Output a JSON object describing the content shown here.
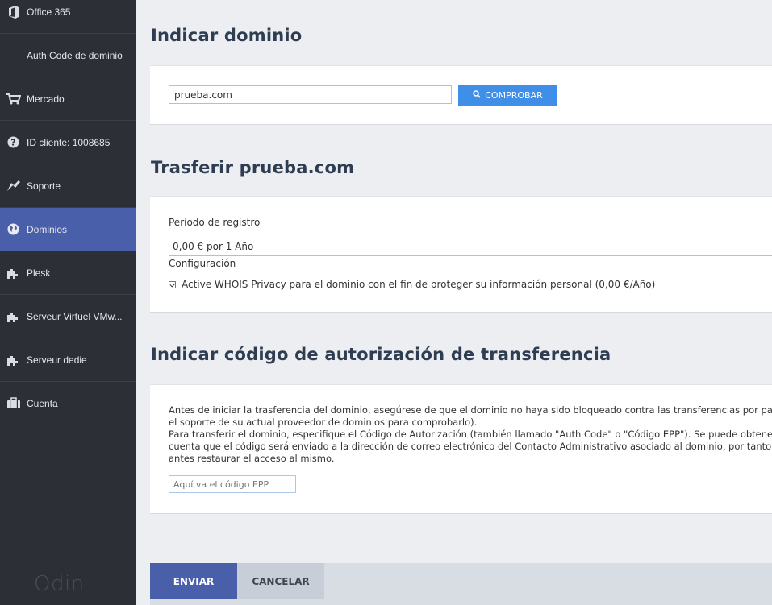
{
  "sidebar": {
    "items": [
      {
        "label": "Office 365",
        "icon": "office-icon"
      },
      {
        "label": "Auth Code de dominio",
        "icon": ""
      },
      {
        "label": "Mercado",
        "icon": "cart-icon"
      },
      {
        "label": "ID cliente: 1008685",
        "icon": "help-icon"
      },
      {
        "label": "Soporte",
        "icon": "support-icon"
      },
      {
        "label": "Dominios",
        "icon": "globe-icon"
      },
      {
        "label": "Plesk",
        "icon": "puzzle-icon"
      },
      {
        "label": "Serveur Virtuel VMw...",
        "icon": "puzzle-icon"
      },
      {
        "label": "Serveur dedie",
        "icon": "puzzle-icon"
      },
      {
        "label": "Cuenta",
        "icon": "briefcase-icon"
      }
    ],
    "active_index": 5,
    "brand": "Odin"
  },
  "colors": {
    "sidebar_bg": "#2c3036",
    "active": "#4a5faa",
    "primary_button": "#3f8ee8"
  },
  "domain_section": {
    "title": "Indicar dominio",
    "input_value": "prueba.com",
    "check_button": "COMPROBAR"
  },
  "transfer_section": {
    "title": "Trasferir prueba.com",
    "period_label": "Período de registro",
    "period_value": "0,00 € por 1 Año",
    "config_label": "Configuración",
    "whois_label": "Active WHOIS Privacy para el dominio con el fin de proteger su información personal (0,00 €/Año)",
    "whois_checked": true
  },
  "auth_section": {
    "title": "Indicar código de autorización de transferencia",
    "lines": [
      "Antes de iniciar la trasferencia del dominio, asegúrese de que el dominio no haya sido bloqueado contra las transferencias por parte d",
      "el soporte de su actual proveedor de dominios para comprobarlo).",
      "Para transferir el dominio, especifique el Código de Autorización (también llamado \"Auth Code\" o \"Código EPP\"). Se puede obtener tras",
      "cuenta que el código será enviado a la dirección de correo electrónico del Contacto Administrativo asociado al dominio, por tanto, si po",
      "antes restaurar el acceso al mismo."
    ],
    "epp_placeholder": "Aquí va el código EPP"
  },
  "footer": {
    "send": "ENVIAR",
    "cancel": "CANCELAR"
  }
}
